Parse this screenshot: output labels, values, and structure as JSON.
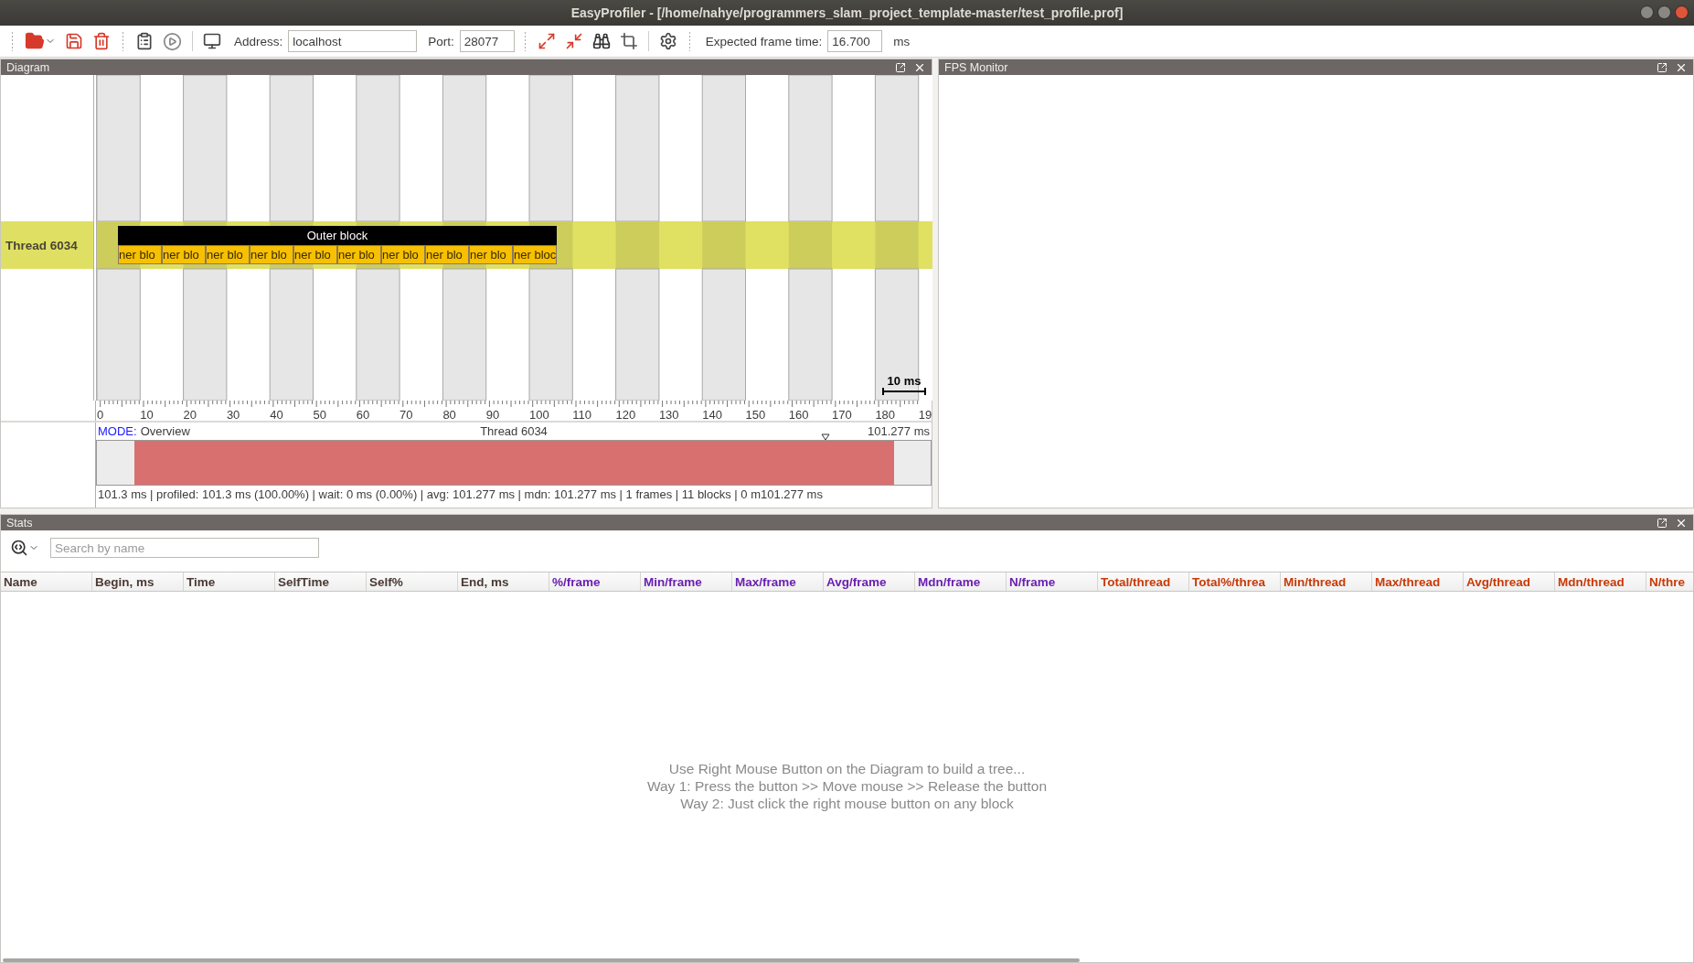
{
  "window": {
    "title": "EasyProfiler - [/home/nahye/programmers_slam_project_template-master/test_profile.prof]"
  },
  "toolbar": {
    "address_label": "Address:",
    "address": "localhost",
    "port_label": "Port:",
    "port": "28077",
    "frame_time_label": "Expected frame time:",
    "frame_time": "16.700",
    "frame_time_unit": "ms"
  },
  "diagram": {
    "title": "Diagram",
    "thread": {
      "name": "Thread 6034",
      "outer_block": "Outer block",
      "inner_blocks": [
        "ner blo",
        "ner blo",
        "ner blo",
        "ner blo",
        "ner blo",
        "ner blo",
        "ner blo",
        "ner blo",
        "ner blo",
        "ner bloc"
      ]
    },
    "scale_label": "10 ms",
    "ruler_labels": [
      "0",
      "10",
      "20",
      "30",
      "40",
      "50",
      "60",
      "70",
      "80",
      "90",
      "100",
      "110",
      "120",
      "130",
      "140",
      "150",
      "160",
      "170",
      "180",
      "19"
    ],
    "overview": {
      "mode_label": "MODE:",
      "mode": "Overview",
      "thread": "Thread 6034",
      "duration": "101.277 ms",
      "status": "101.3 ms | profiled: 101.3 ms (100.00%) | wait: 0 ms (0.00%) | avg: 101.277 ms | mdn: 101.277 ms | 1 frames | 11 blocks | 0 m",
      "status_end": "101.277 ms"
    }
  },
  "fps_monitor": {
    "title": "FPS Monitor"
  },
  "stats": {
    "title": "Stats",
    "search": {
      "placeholder": "Search by name"
    },
    "columns": [
      {
        "label": "Name",
        "color": "#4a3a34"
      },
      {
        "label": "Begin, ms",
        "color": "#4a3a34"
      },
      {
        "label": "Time",
        "color": "#4a3a34"
      },
      {
        "label": "SelfTime",
        "color": "#4a3a34"
      },
      {
        "label": "Self%",
        "color": "#4a3a34"
      },
      {
        "label": "End, ms",
        "color": "#4a3a34"
      },
      {
        "label": "%/frame",
        "color": "#6b1fb1"
      },
      {
        "label": "Min/frame",
        "color": "#6b1fb1"
      },
      {
        "label": "Max/frame",
        "color": "#6b1fb1"
      },
      {
        "label": "Avg/frame",
        "color": "#6b1fb1"
      },
      {
        "label": "Mdn/frame",
        "color": "#6b1fb1"
      },
      {
        "label": "N/frame",
        "color": "#6b1fb1"
      },
      {
        "label": "Total/thread",
        "color": "#c83a08"
      },
      {
        "label": "Total%/threa",
        "color": "#c83a08"
      },
      {
        "label": "Min/thread",
        "color": "#c83a08"
      },
      {
        "label": "Max/thread",
        "color": "#c83a08"
      },
      {
        "label": "Avg/thread",
        "color": "#c83a08"
      },
      {
        "label": "Mdn/thread",
        "color": "#c83a08"
      },
      {
        "label": "N/thre",
        "color": "#c83a08"
      }
    ],
    "hint_lines": [
      "Use Right Mouse Button on the Diagram to build a tree...",
      "Way 1: Press the button >> Move mouse >> Release the button",
      "Way 2: Just click the right mouse button on any block"
    ]
  }
}
